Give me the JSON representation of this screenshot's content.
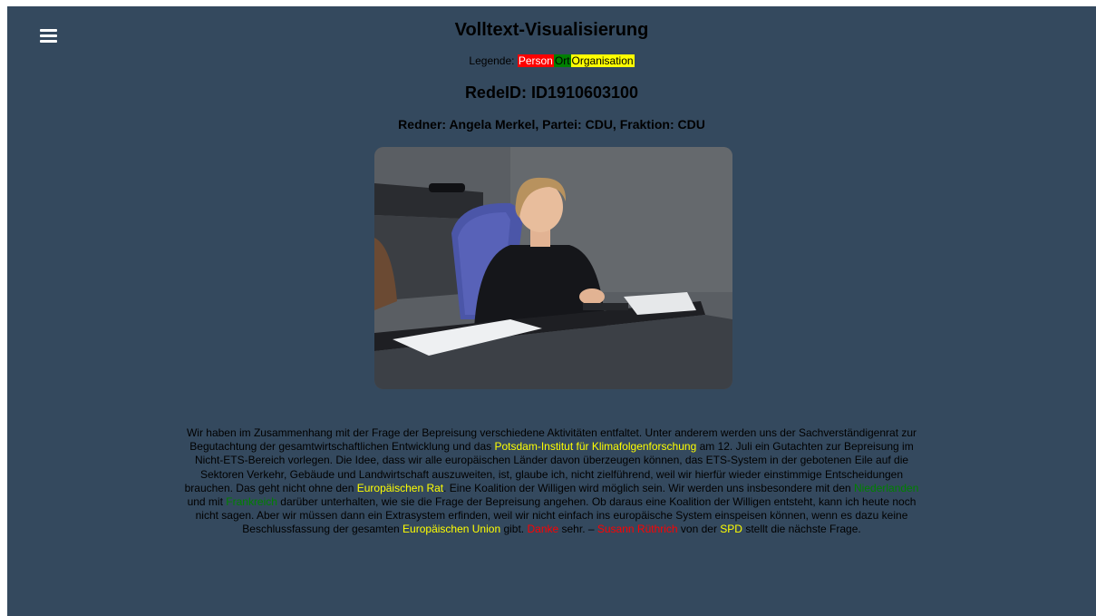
{
  "menu": {
    "icon": "hamburger-menu-icon"
  },
  "header": {
    "title": "Volltext-Visualisierung",
    "legend_label": "Legende:",
    "legend_person": "Person",
    "legend_ort": "Ort",
    "legend_org": "Organisation",
    "rede_id": "RedeID: ID1910603100",
    "speaker_line": "Redner: Angela Merkel, Partei: CDU, Fraktion: CDU"
  },
  "colors": {
    "background": "#34495e",
    "person": "#ff0000",
    "ort": "#008000",
    "organisation": "#ffff00"
  },
  "speech": {
    "s1": "Wir haben im Zusammenhang mit der Frage der Bepreisung verschiedene Aktivitäten entfaltet. Unter anderem werden uns der Sachverständigenrat zur Begutachtung der gesamtwirtschaftlichen Entwicklung und das ",
    "e1": "Potsdam-Institut für Klimafolgenforschung",
    "s2": " am 12. Juli ein Gutachten zur Bepreisung im Nicht-ETS-Bereich vorlegen. Die Idee, dass wir alle europäischen Länder davon überzeugen können, das ETS-System in der gebotenen Eile auf die Sektoren Verkehr, Gebäude und Landwirtschaft auszuweiten, ist, glaube ich, nicht zielführend, weil wir hierfür wieder einstimmige Entscheidungen brauchen. Das geht nicht ohne den ",
    "e2": "Europäischen Rat",
    "s3": ". Eine Koalition der Willigen wird möglich sein. Wir werden uns insbesondere mit den ",
    "e3": "Niederlanden",
    "s4": " und mit ",
    "e4": "Frankreich",
    "s5": " darüber unterhalten, wie sie die Frage der Bepreisung angehen. Ob daraus eine Koalition der Willigen entsteht, kann ich heute noch nicht sagen. Aber wir müssen dann ein Extrasystem erfinden, weil wir nicht einfach ins europäische System einspeisen können, wenn es dazu keine Beschlussfassung der gesamten ",
    "e5": "Europäischen Union",
    "s6": " gibt. ",
    "e6": "Danke",
    "s7": " sehr. – ",
    "e7": "Susann Rüthrich",
    "s8": " von der ",
    "e8": "SPD",
    "s9": " stellt die nächste Frage."
  }
}
